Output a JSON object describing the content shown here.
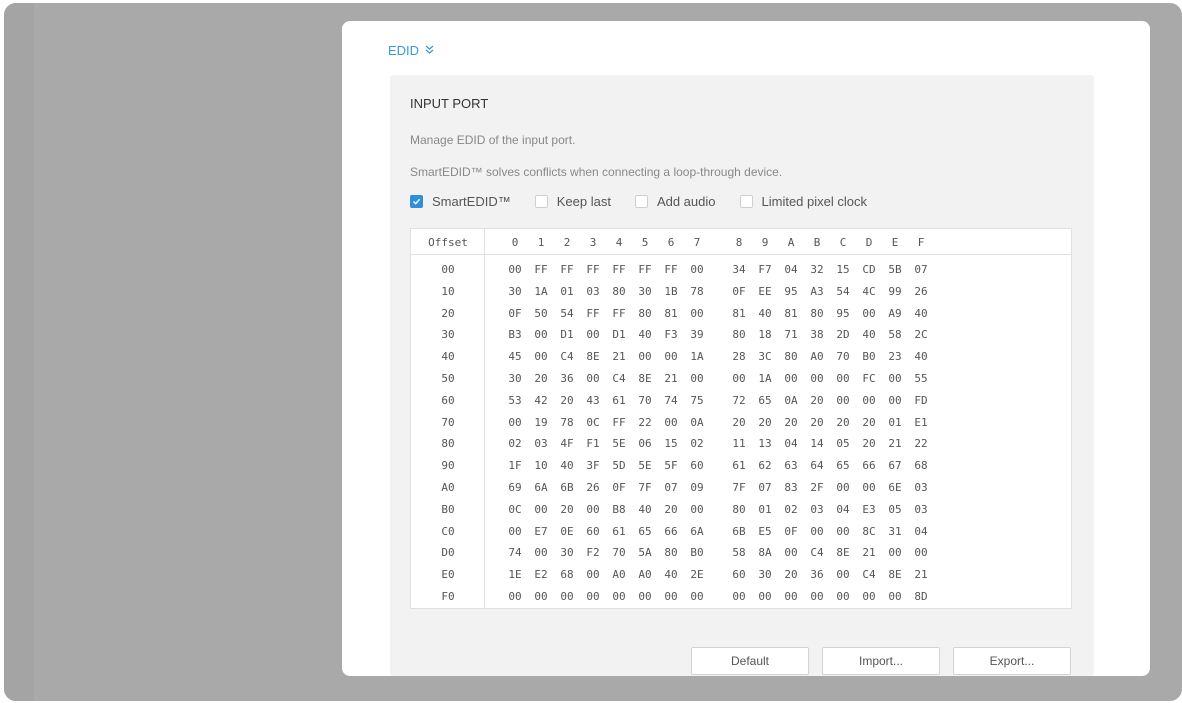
{
  "edid": {
    "title": "EDID",
    "chevron_icon": "double-chevron-down-icon"
  },
  "card": {
    "title": "INPUT PORT",
    "desc1": "Manage EDID of the input port.",
    "desc2": "SmartEDID™ solves conflicts when connecting a loop-through device."
  },
  "options": [
    {
      "label": "SmartEDID™",
      "checked": true
    },
    {
      "label": "Keep last",
      "checked": false
    },
    {
      "label": "Add audio",
      "checked": false
    },
    {
      "label": "Limited pixel clock",
      "checked": false
    }
  ],
  "table": {
    "offset_header": "Offset",
    "columns": [
      "0",
      "1",
      "2",
      "3",
      "4",
      "5",
      "6",
      "7",
      "8",
      "9",
      "A",
      "B",
      "C",
      "D",
      "E",
      "F"
    ],
    "rows": [
      {
        "offset": "00",
        "bytes": [
          "00",
          "FF",
          "FF",
          "FF",
          "FF",
          "FF",
          "FF",
          "00",
          "34",
          "F7",
          "04",
          "32",
          "15",
          "CD",
          "5B",
          "07"
        ]
      },
      {
        "offset": "10",
        "bytes": [
          "30",
          "1A",
          "01",
          "03",
          "80",
          "30",
          "1B",
          "78",
          "0F",
          "EE",
          "95",
          "A3",
          "54",
          "4C",
          "99",
          "26"
        ]
      },
      {
        "offset": "20",
        "bytes": [
          "0F",
          "50",
          "54",
          "FF",
          "FF",
          "80",
          "81",
          "00",
          "81",
          "40",
          "81",
          "80",
          "95",
          "00",
          "A9",
          "40"
        ]
      },
      {
        "offset": "30",
        "bytes": [
          "B3",
          "00",
          "D1",
          "00",
          "D1",
          "40",
          "F3",
          "39",
          "80",
          "18",
          "71",
          "38",
          "2D",
          "40",
          "58",
          "2C"
        ]
      },
      {
        "offset": "40",
        "bytes": [
          "45",
          "00",
          "C4",
          "8E",
          "21",
          "00",
          "00",
          "1A",
          "28",
          "3C",
          "80",
          "A0",
          "70",
          "B0",
          "23",
          "40"
        ]
      },
      {
        "offset": "50",
        "bytes": [
          "30",
          "20",
          "36",
          "00",
          "C4",
          "8E",
          "21",
          "00",
          "00",
          "1A",
          "00",
          "00",
          "00",
          "FC",
          "00",
          "55"
        ]
      },
      {
        "offset": "60",
        "bytes": [
          "53",
          "42",
          "20",
          "43",
          "61",
          "70",
          "74",
          "75",
          "72",
          "65",
          "0A",
          "20",
          "00",
          "00",
          "00",
          "FD"
        ]
      },
      {
        "offset": "70",
        "bytes": [
          "00",
          "19",
          "78",
          "0C",
          "FF",
          "22",
          "00",
          "0A",
          "20",
          "20",
          "20",
          "20",
          "20",
          "20",
          "01",
          "E1"
        ]
      },
      {
        "offset": "80",
        "bytes": [
          "02",
          "03",
          "4F",
          "F1",
          "5E",
          "06",
          "15",
          "02",
          "11",
          "13",
          "04",
          "14",
          "05",
          "20",
          "21",
          "22"
        ]
      },
      {
        "offset": "90",
        "bytes": [
          "1F",
          "10",
          "40",
          "3F",
          "5D",
          "5E",
          "5F",
          "60",
          "61",
          "62",
          "63",
          "64",
          "65",
          "66",
          "67",
          "68"
        ]
      },
      {
        "offset": "A0",
        "bytes": [
          "69",
          "6A",
          "6B",
          "26",
          "0F",
          "7F",
          "07",
          "09",
          "7F",
          "07",
          "83",
          "2F",
          "00",
          "00",
          "6E",
          "03"
        ]
      },
      {
        "offset": "B0",
        "bytes": [
          "0C",
          "00",
          "20",
          "00",
          "B8",
          "40",
          "20",
          "00",
          "80",
          "01",
          "02",
          "03",
          "04",
          "E3",
          "05",
          "03"
        ]
      },
      {
        "offset": "C0",
        "bytes": [
          "00",
          "E7",
          "0E",
          "60",
          "61",
          "65",
          "66",
          "6A",
          "6B",
          "E5",
          "0F",
          "00",
          "00",
          "8C",
          "31",
          "04"
        ]
      },
      {
        "offset": "D0",
        "bytes": [
          "74",
          "00",
          "30",
          "F2",
          "70",
          "5A",
          "80",
          "B0",
          "58",
          "8A",
          "00",
          "C4",
          "8E",
          "21",
          "00",
          "00"
        ]
      },
      {
        "offset": "E0",
        "bytes": [
          "1E",
          "E2",
          "68",
          "00",
          "A0",
          "A0",
          "40",
          "2E",
          "60",
          "30",
          "20",
          "36",
          "00",
          "C4",
          "8E",
          "21"
        ]
      },
      {
        "offset": "F0",
        "bytes": [
          "00",
          "00",
          "00",
          "00",
          "00",
          "00",
          "00",
          "00",
          "00",
          "00",
          "00",
          "00",
          "00",
          "00",
          "00",
          "8D"
        ]
      }
    ]
  },
  "buttons": {
    "default": "Default",
    "import": "Import...",
    "export": "Export..."
  },
  "colors": {
    "accent": "#2f8fdc",
    "link": "#3a9ad9"
  }
}
